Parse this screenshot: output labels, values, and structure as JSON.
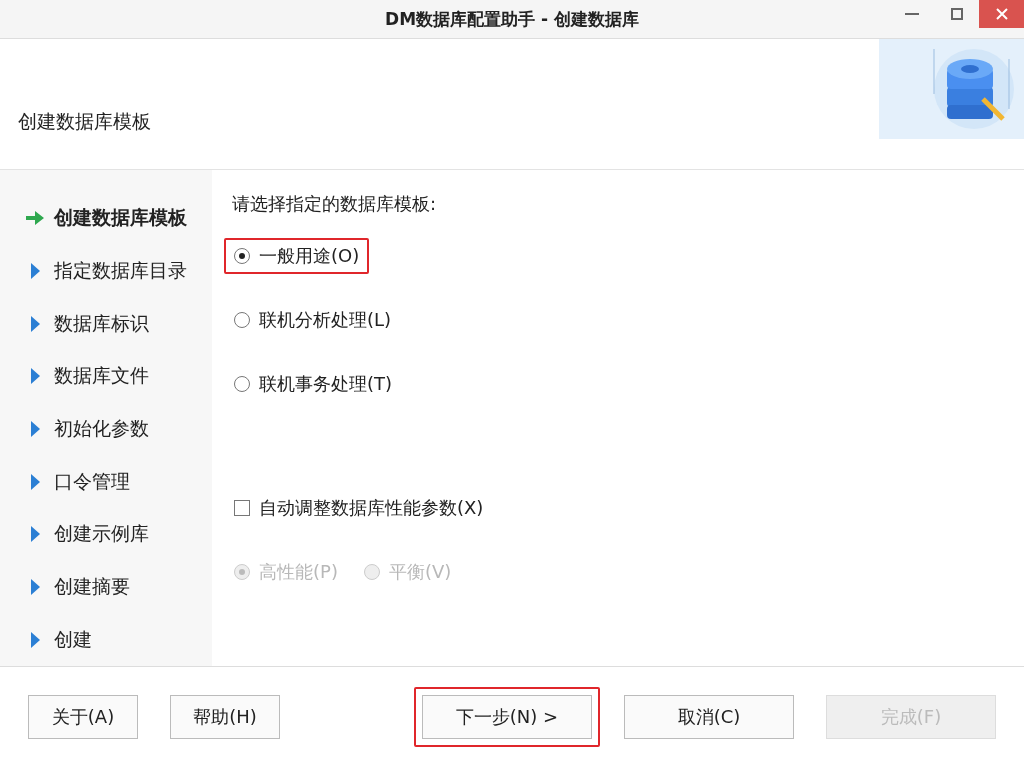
{
  "window": {
    "title": "DM数据库配置助手 - 创建数据库"
  },
  "header": {
    "title": "创建数据库模板"
  },
  "steps": [
    {
      "label": "创建数据库模板",
      "selected": true
    },
    {
      "label": "指定数据库目录",
      "selected": false
    },
    {
      "label": "数据库标识",
      "selected": false
    },
    {
      "label": "数据库文件",
      "selected": false
    },
    {
      "label": "初始化参数",
      "selected": false
    },
    {
      "label": "口令管理",
      "selected": false
    },
    {
      "label": "创建示例库",
      "selected": false
    },
    {
      "label": "创建摘要",
      "selected": false
    },
    {
      "label": "创建",
      "selected": false
    }
  ],
  "prompt": "请选择指定的数据库模板:",
  "templates": [
    {
      "label": "一般用途(O)",
      "selected": true,
      "highlighted": true
    },
    {
      "label": "联机分析处理(L)",
      "selected": false,
      "highlighted": false
    },
    {
      "label": "联机事务处理(T)",
      "selected": false,
      "highlighted": false
    }
  ],
  "auto_tune": {
    "label": "自动调整数据库性能参数(X)",
    "checked": false
  },
  "tune_modes": [
    {
      "label": "高性能(P)",
      "selected": true,
      "disabled": true
    },
    {
      "label": "平衡(V)",
      "selected": false,
      "disabled": true
    }
  ],
  "left_buttons": [
    {
      "label": "关于(A)",
      "disabled": false,
      "highlighted": false
    },
    {
      "label": "帮助(H)",
      "disabled": false,
      "highlighted": false
    }
  ],
  "right_buttons": [
    {
      "label": "下一步(N) >",
      "disabled": false,
      "highlighted": true
    },
    {
      "label": "取消(C)",
      "disabled": false,
      "highlighted": false
    },
    {
      "label": "完成(F)",
      "disabled": true,
      "highlighted": false
    }
  ]
}
